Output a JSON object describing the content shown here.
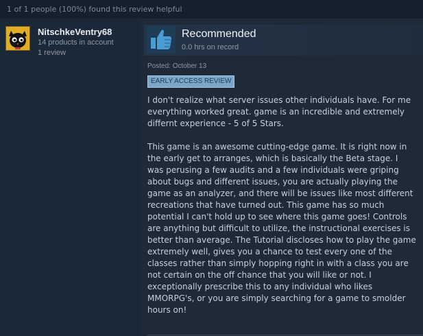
{
  "helpful_line": "1 of 1 people (100%) found this review helpful",
  "author": {
    "persona_name": "NitschkeVentry68",
    "num_owned": "14 products in account",
    "num_reviews": "1 review",
    "avatar_icon": "black-cat-avatar-icon"
  },
  "review": {
    "vote_label": "Recommended",
    "vote_icon": "thumbs-up-icon",
    "hours": "0.0 hrs on record",
    "posted": "Posted: October 13",
    "badge": "EARLY ACCESS REVIEW",
    "paragraphs": [
      "I don't realize what server issues other individuals have. For me everything worked great. game is an incredible and extremely differnt experience - 5 of 5 Stars.",
      "This game is an awesome cutting-edge game. It is right now in the early get to arranges, which is basically the Beta stage. I was perusing a few audits and a few individuals were griping about bugs and different issues, you are actually playing the game as an analyzer, and there will be issues like most different recreations that have turned out. This game has so much potential I can't hold up to see where this game goes! Controls are anything but difficult to utilize, the instructional exercises is better than average. The Tutorial discloses how to play the game extremely well, gives you a chance to test every one of the classes rather than simply hopping right in with a class you are not certain on the off chance that you will like or not. I exceptionally prescribe this to any individual who likes MMORPG's, or you are simply searching for a game to smolder hours on!"
    ]
  },
  "colors": {
    "background": "#1b2838",
    "thumb_accent": "#4c9bd1",
    "badge_bg": "#7aa7c9",
    "name_text": "#e8eef3"
  }
}
